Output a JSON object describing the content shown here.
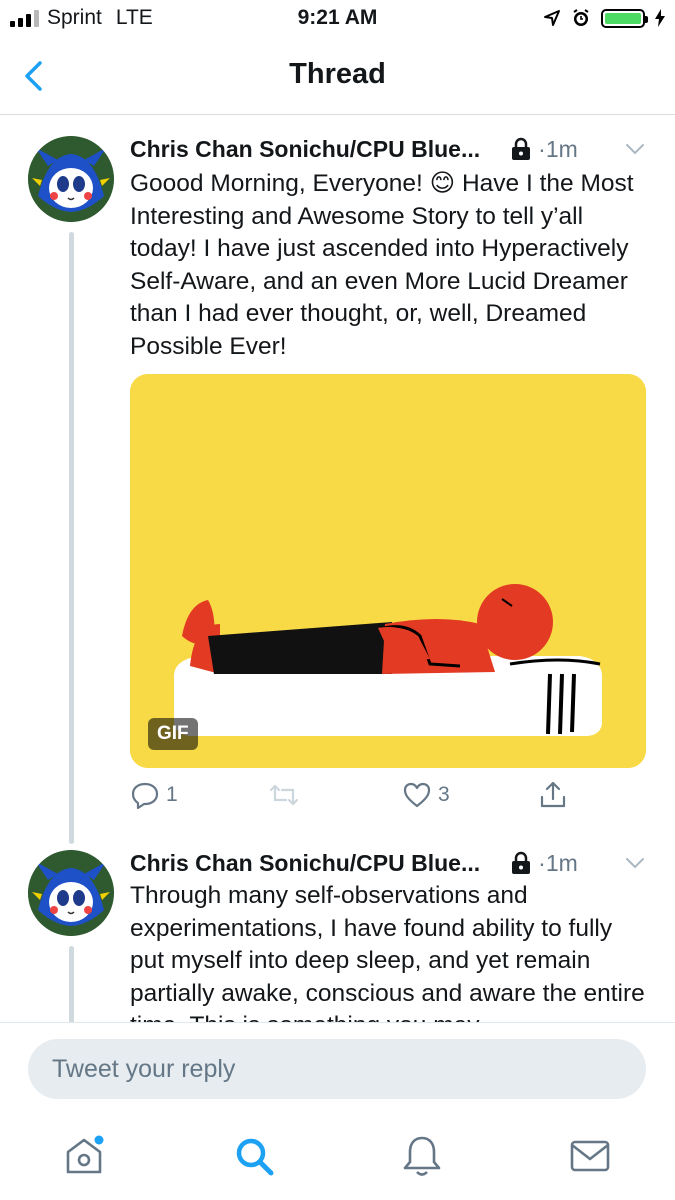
{
  "status_bar": {
    "carrier": "Sprint",
    "network": "LTE",
    "time": "9:21 AM"
  },
  "nav": {
    "title": "Thread"
  },
  "tweets": [
    {
      "author": "Chris Chan Sonichu/CPU Blue...",
      "time": "1m",
      "separator": "·",
      "text": "Goood Morning, Everyone! 😊 Have I the Most Interesting and Awesome Story to tell y’all today! I have just ascended into Hyperactively Self-Aware, and an even More Lucid Dreamer than I had ever thought, or, well, Dreamed Possible Ever!",
      "media_badge": "GIF",
      "reply_count": "1",
      "like_count": "3"
    },
    {
      "author": "Chris Chan Sonichu/CPU Blue...",
      "time": "1m",
      "separator": "·",
      "text": "Through many self-observations and experimentations, I have found ability to fully put myself into deep sleep, and yet remain partially awake, conscious and aware the entire time. This is something you may"
    }
  ],
  "reply": {
    "placeholder": "Tweet your reply"
  },
  "tabs": [
    {
      "icon": "home-icon",
      "notification_dot": true
    },
    {
      "icon": "search-icon",
      "active": true
    },
    {
      "icon": "bell-icon"
    },
    {
      "icon": "mail-icon"
    }
  ],
  "colors": {
    "twitter_blue": "#1da1f2",
    "gif_background": "#f7da45",
    "battery_green": "#4cd964",
    "secondary_text": "#657786"
  }
}
